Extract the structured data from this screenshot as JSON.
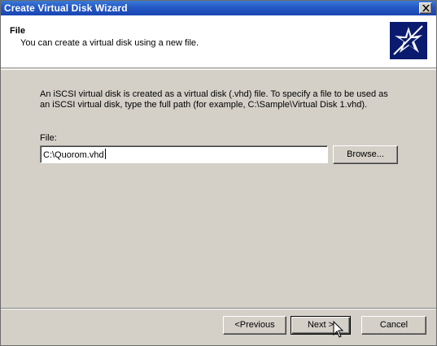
{
  "window": {
    "title": "Create Virtual Disk Wizard"
  },
  "header": {
    "title": "File",
    "subtitle": "You can create a virtual disk using a new file.",
    "icon": "wizard-star-icon"
  },
  "body": {
    "description_line1": "An iSCSI virtual disk is created as a virtual disk (.vhd) file. To specify a file to be used as",
    "description_line2": "an iSCSI virtual disk, type the full path (for example, C:\\Sample\\Virtual Disk 1.vhd).",
    "file_label": "File:",
    "file_value": "C:\\Quorom.vhd",
    "browse_label": "Browse..."
  },
  "footer": {
    "previous_label": "<Previous",
    "next_label": "Next >",
    "cancel_label": "Cancel"
  },
  "colors": {
    "titlebar": "#2458c4",
    "dialog_bg": "#d4d0c8",
    "header_bg": "#ffffff",
    "icon_bg": "#0a1a6e"
  }
}
